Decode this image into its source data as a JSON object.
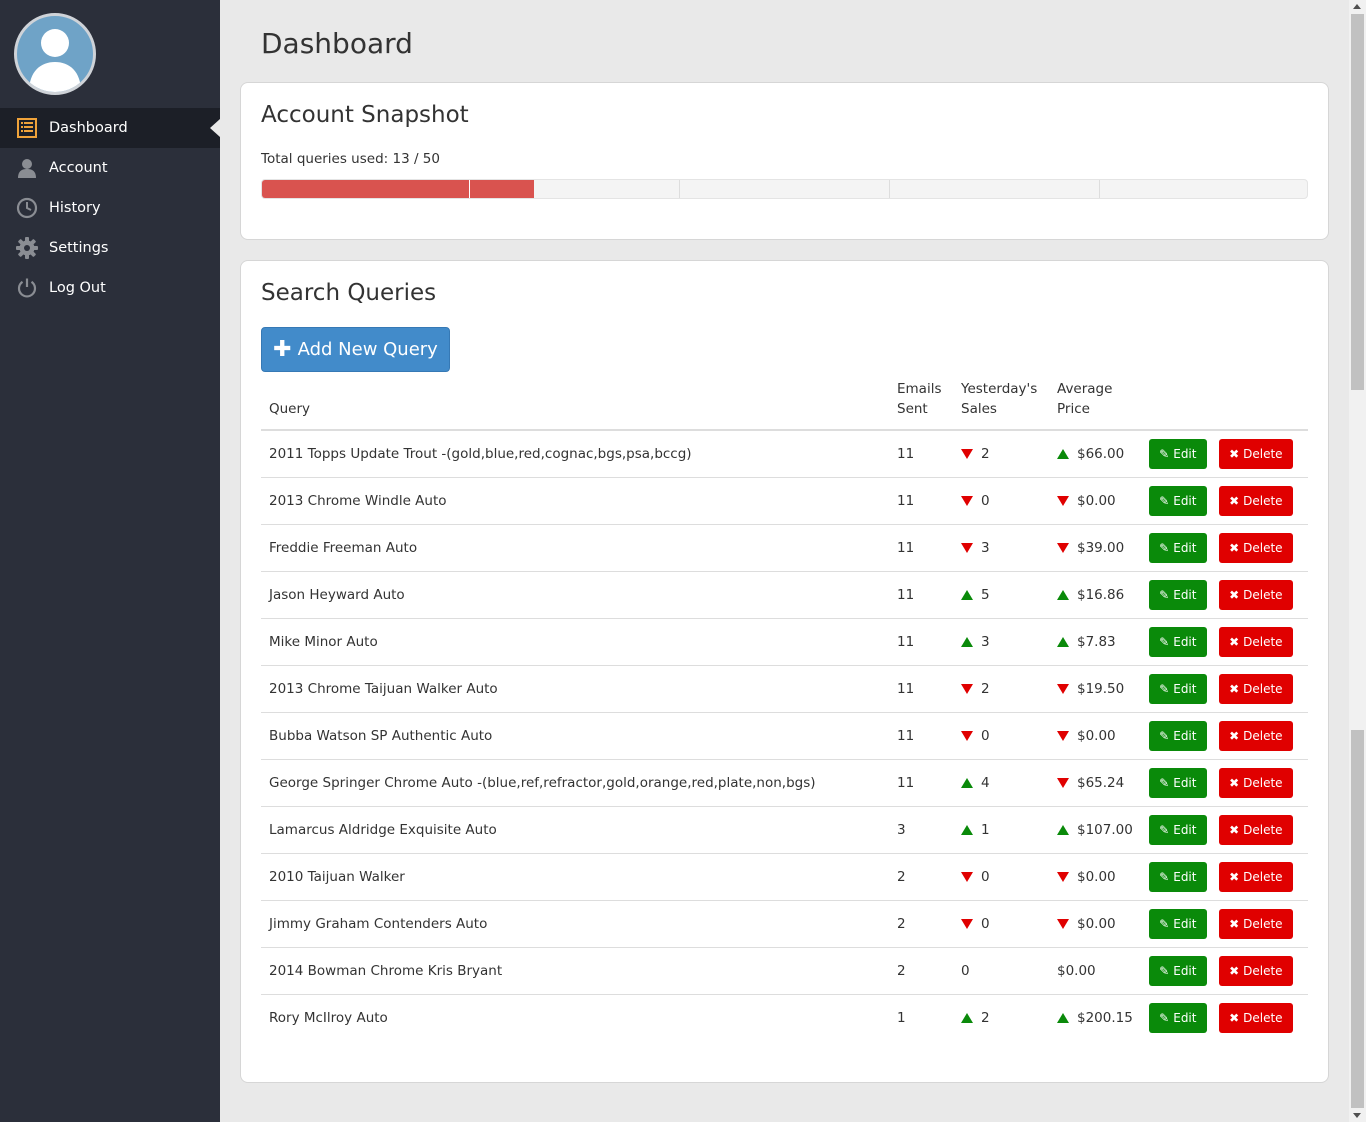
{
  "page": {
    "title": "Dashboard"
  },
  "sidebar": {
    "items": [
      {
        "label": "Dashboard",
        "icon": "list-icon",
        "active": true
      },
      {
        "label": "Account",
        "icon": "user-icon",
        "active": false
      },
      {
        "label": "History",
        "icon": "clock-icon",
        "active": false
      },
      {
        "label": "Settings",
        "icon": "gear-icon",
        "active": false
      },
      {
        "label": "Log Out",
        "icon": "power-icon",
        "active": false
      }
    ]
  },
  "snapshot": {
    "title": "Account Snapshot",
    "usage_label": "Total queries used: 13 / 50",
    "used": 13,
    "total": 50
  },
  "queries": {
    "title": "Search Queries",
    "add_button_label": "Add New Query",
    "headers": {
      "query": "Query",
      "emails_line1": "Emails",
      "emails_line2": "Sent",
      "sales_line1": "Yesterday's",
      "sales_line2": "Sales",
      "price_line1": "Average",
      "price_line2": "Price"
    },
    "edit_label": "Edit",
    "delete_label": "Delete",
    "rows": [
      {
        "query": "2011 Topps Update Trout -(gold,blue,red,cognac,bgs,psa,bccg)",
        "emails": "11",
        "sales": "2",
        "sales_trend": "down",
        "price": "$66.00",
        "price_trend": "up"
      },
      {
        "query": "2013 Chrome Windle Auto",
        "emails": "11",
        "sales": "0",
        "sales_trend": "down",
        "price": "$0.00",
        "price_trend": "down"
      },
      {
        "query": "Freddie Freeman Auto",
        "emails": "11",
        "sales": "3",
        "sales_trend": "down",
        "price": "$39.00",
        "price_trend": "down"
      },
      {
        "query": "Jason Heyward Auto",
        "emails": "11",
        "sales": "5",
        "sales_trend": "up",
        "price": "$16.86",
        "price_trend": "up"
      },
      {
        "query": "Mike Minor Auto",
        "emails": "11",
        "sales": "3",
        "sales_trend": "up",
        "price": "$7.83",
        "price_trend": "up"
      },
      {
        "query": "2013 Chrome Taijuan Walker Auto",
        "emails": "11",
        "sales": "2",
        "sales_trend": "down",
        "price": "$19.50",
        "price_trend": "down"
      },
      {
        "query": "Bubba Watson SP Authentic Auto",
        "emails": "11",
        "sales": "0",
        "sales_trend": "down",
        "price": "$0.00",
        "price_trend": "down"
      },
      {
        "query": "George Springer Chrome Auto -(blue,ref,refractor,gold,orange,red,plate,non,bgs)",
        "emails": "11",
        "sales": "4",
        "sales_trend": "up",
        "price": "$65.24",
        "price_trend": "down"
      },
      {
        "query": "Lamarcus Aldridge Exquisite Auto",
        "emails": "3",
        "sales": "1",
        "sales_trend": "up",
        "price": "$107.00",
        "price_trend": "up"
      },
      {
        "query": "2010 Taijuan Walker",
        "emails": "2",
        "sales": "0",
        "sales_trend": "down",
        "price": "$0.00",
        "price_trend": "down"
      },
      {
        "query": "Jimmy Graham Contenders Auto",
        "emails": "2",
        "sales": "0",
        "sales_trend": "down",
        "price": "$0.00",
        "price_trend": "down"
      },
      {
        "query": "2014 Bowman Chrome Kris Bryant",
        "emails": "2",
        "sales": "0",
        "sales_trend": "none",
        "price": "$0.00",
        "price_trend": "none"
      },
      {
        "query": "Rory McIlroy Auto",
        "emails": "1",
        "sales": "2",
        "sales_trend": "up",
        "price": "$200.15",
        "price_trend": "up"
      }
    ]
  },
  "colors": {
    "sidebar_bg": "#2b2f3a",
    "progress_fill": "#d9534f",
    "primary_button": "#428bca",
    "edit_button": "#0a8a0a",
    "delete_button": "#e00000",
    "trend_up": "#0a8a0a",
    "trend_down": "#e00000"
  }
}
